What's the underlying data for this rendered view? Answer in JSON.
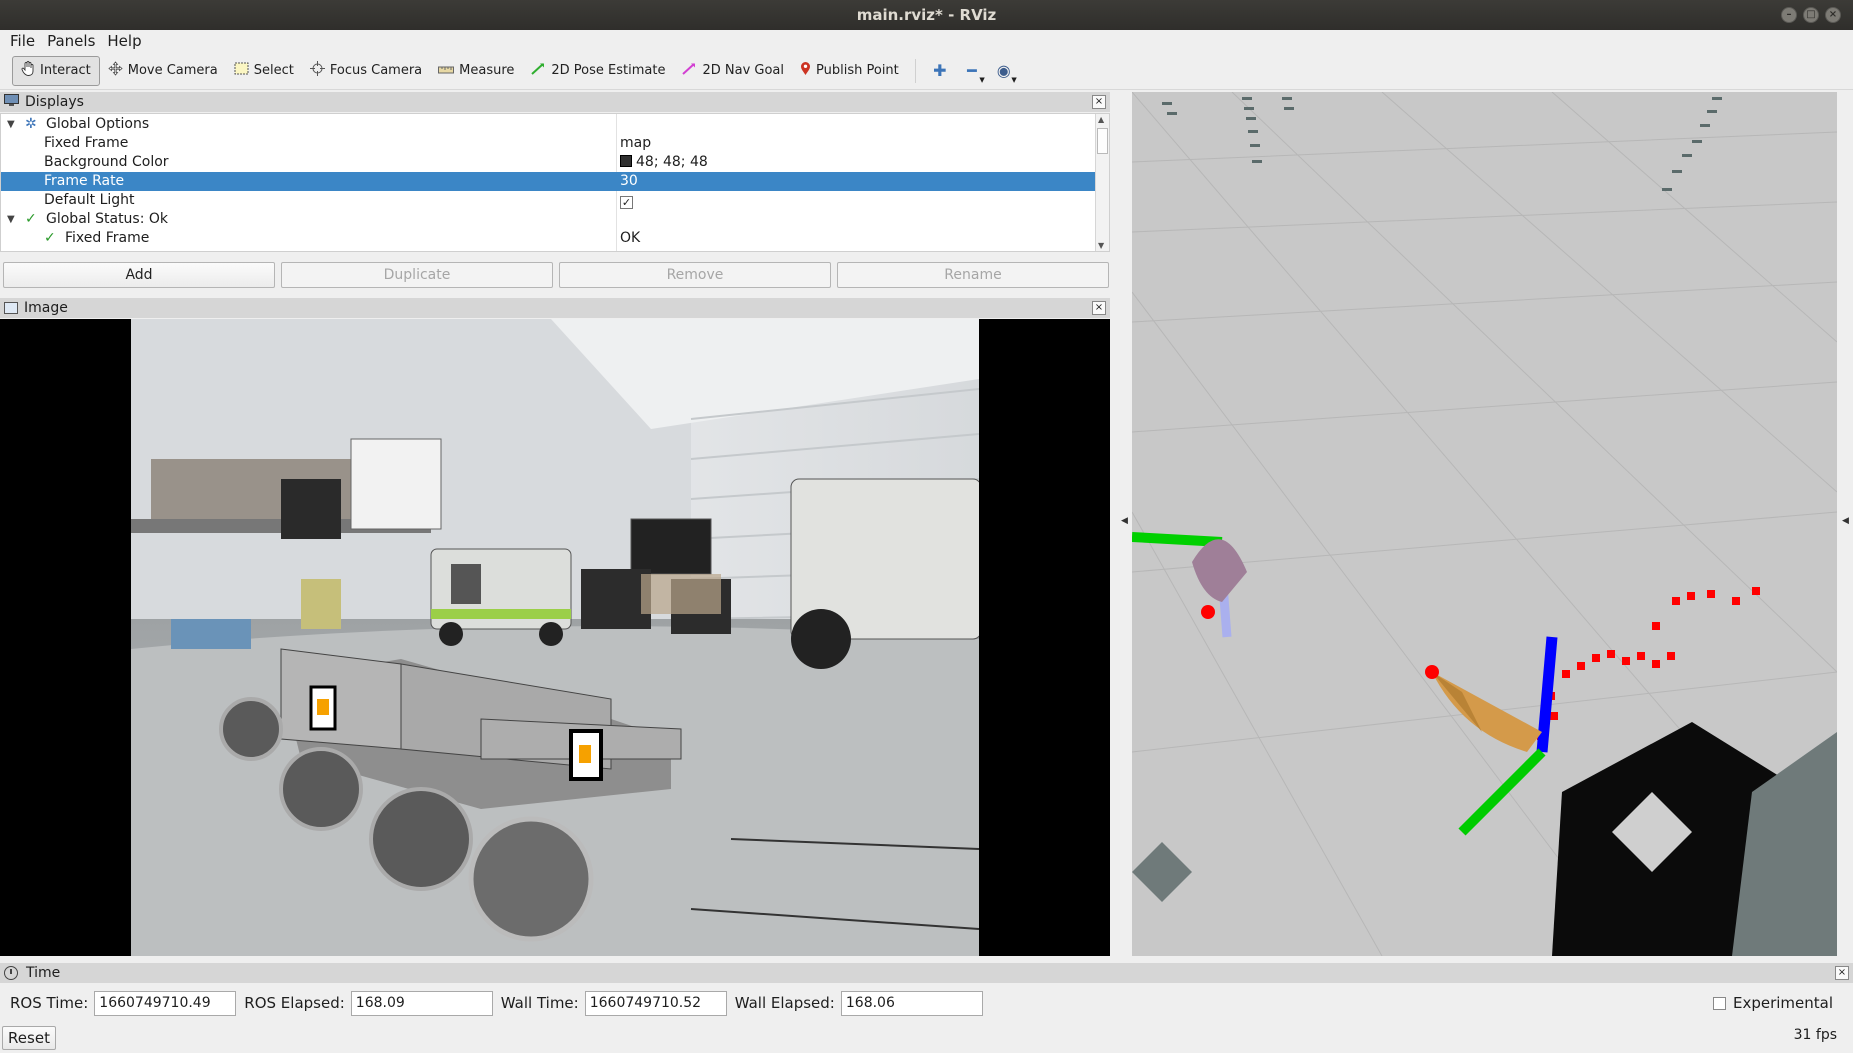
{
  "window": {
    "title": "main.rviz* - RViz",
    "controls": [
      "minimize",
      "maximize",
      "close"
    ]
  },
  "menubar": [
    "File",
    "Panels",
    "Help"
  ],
  "toolbar": {
    "tools": [
      {
        "label": "Interact",
        "icon": "hand-icon",
        "active": true
      },
      {
        "label": "Move Camera",
        "icon": "move-camera-icon"
      },
      {
        "label": "Select",
        "icon": "select-icon"
      },
      {
        "label": "Focus Camera",
        "icon": "focus-camera-icon"
      },
      {
        "label": "Measure",
        "icon": "measure-icon"
      },
      {
        "label": "2D Pose Estimate",
        "icon": "pose-estimate-icon",
        "color": "#2fae2f"
      },
      {
        "label": "2D Nav Goal",
        "icon": "nav-goal-icon",
        "color": "#d23fd2"
      },
      {
        "label": "Publish Point",
        "icon": "map-pin-icon",
        "color": "#cc3322"
      }
    ],
    "extra_icons": [
      "plus-icon",
      "minus-icon",
      "eye-icon"
    ]
  },
  "displays": {
    "title": "Displays",
    "rows": [
      {
        "label": "Global Options",
        "value": ""
      },
      {
        "label": "Fixed Frame",
        "value": "map"
      },
      {
        "label": "Background Color",
        "value": "48; 48; 48"
      },
      {
        "label": "Frame Rate",
        "value": "30",
        "selected": true
      },
      {
        "label": "Default Light",
        "value": "✓"
      },
      {
        "label": "Global Status: Ok",
        "value": ""
      },
      {
        "label": "Fixed Frame",
        "value": "OK"
      }
    ],
    "buttons": {
      "add": "Add",
      "duplicate": "Duplicate",
      "remove": "Remove",
      "rename": "Rename"
    }
  },
  "image_panel": {
    "title": "Image"
  },
  "time_panel": {
    "title": "Time",
    "ros_time_label": "ROS Time:",
    "ros_time": "1660749710.49",
    "ros_elapsed_label": "ROS Elapsed:",
    "ros_elapsed": "168.09",
    "wall_time_label": "Wall Time:",
    "wall_time": "1660749710.52",
    "wall_elapsed_label": "Wall Elapsed:",
    "wall_elapsed": "168.06",
    "experimental_label": "Experimental",
    "experimental_checked": false,
    "reset": "Reset",
    "fps": "31 fps"
  },
  "colors": {
    "selection": "#3b86c6",
    "panel_header": "#d6d6d6",
    "view3d_background": "#c8c8c8",
    "laser_points": "#ff0000",
    "axis_x": "#ff0000",
    "axis_y": "#00cc00",
    "axis_z": "#0000ff"
  }
}
